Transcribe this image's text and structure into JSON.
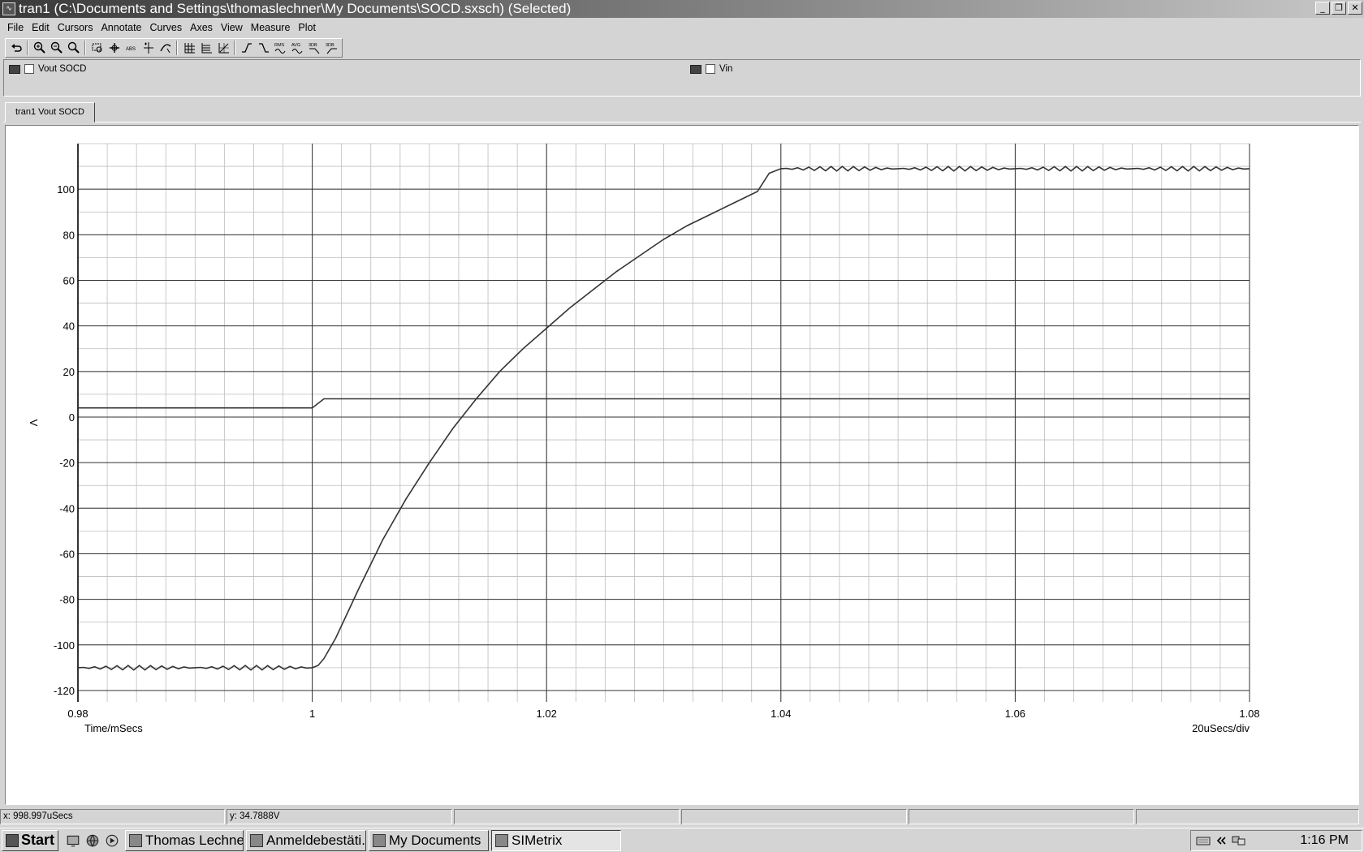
{
  "window": {
    "title": "tran1 (C:\\Documents and Settings\\thomaslechner\\My Documents\\SOCD.sxsch) (Selected)",
    "app_icon": "simetrix-icon",
    "controls": [
      "minimize-icon",
      "restore-icon",
      "close-icon"
    ]
  },
  "menu": [
    "File",
    "Edit",
    "Cursors",
    "Annotate",
    "Curves",
    "Axes",
    "View",
    "Measure",
    "Plot"
  ],
  "toolbar": {
    "groups": [
      [
        "undo-icon"
      ],
      [
        "zoom-in-icon",
        "zoom-out-icon",
        "zoom-full-icon"
      ],
      [
        "zoom-box-icon",
        "pan-icon",
        "abs-icon",
        "cursor-add-icon",
        "curve-select-icon"
      ],
      [
        "grid-icon",
        "separate-axes-icon",
        "log-axes-icon"
      ],
      [
        "rise-time-icon",
        "fall-time-icon",
        "rms-icon",
        "avg-icon",
        "3db-low-icon",
        "3db-high-icon"
      ]
    ],
    "text_icons": {
      "abs-icon": "ABS",
      "rms-icon": "RMS",
      "avg-icon": "AVG",
      "3db-low-icon": "3DB",
      "3db-high-icon": "3DB"
    }
  },
  "legend": [
    {
      "label": "Vout SOCD",
      "color": "#444444"
    },
    {
      "label": "Vin",
      "color": "#444444"
    }
  ],
  "tabs": [
    {
      "label": "tran1 Vout SOCD",
      "active": true
    }
  ],
  "chart_data": {
    "type": "line",
    "xlabel": "Time/mSecs",
    "ylabel": "V",
    "xdiv_label": "20uSecs/div",
    "xlim": [
      0.98,
      1.08
    ],
    "ylim": [
      -125,
      120
    ],
    "x_ticks": [
      0.98,
      1,
      1.02,
      1.04,
      1.06,
      1.08
    ],
    "x_tick_labels": [
      "0.98",
      "1",
      "1.02",
      "1.04",
      "1.06",
      "1.08"
    ],
    "y_ticks": [
      -120,
      -100,
      -80,
      -60,
      -40,
      -20,
      0,
      20,
      40,
      60,
      80,
      100
    ],
    "y_tick_labels": [
      "-120",
      "-100",
      "-80",
      "-60",
      "-40",
      "-20",
      "0",
      "20",
      "40",
      "60",
      "80",
      "100"
    ],
    "grid": true,
    "series": [
      {
        "name": "Vout SOCD",
        "color": "#333333",
        "x": [
          0.98,
          0.99,
          1.0,
          1.0005,
          1.001,
          1.002,
          1.003,
          1.004,
          1.006,
          1.008,
          1.01,
          1.012,
          1.014,
          1.016,
          1.018,
          1.02,
          1.022,
          1.024,
          1.026,
          1.028,
          1.03,
          1.032,
          1.034,
          1.036,
          1.038,
          1.039,
          1.04,
          1.05,
          1.06,
          1.07,
          1.08
        ],
        "y": [
          -110,
          -110,
          -110,
          -109,
          -106,
          -97,
          -86,
          -75,
          -54,
          -36,
          -20,
          -5,
          8,
          20,
          30,
          39,
          48,
          56,
          64,
          71,
          78,
          84,
          89,
          94,
          99,
          107,
          109,
          109,
          109,
          109,
          109
        ],
        "ripple": 1
      },
      {
        "name": "Vin",
        "color": "#333333",
        "x": [
          0.98,
          1.0,
          1.001,
          1.08
        ],
        "y": [
          4,
          4,
          8,
          8
        ]
      }
    ]
  },
  "status": {
    "x_readout": "x: 998.997uSecs",
    "y_readout": "y: 34.7888V"
  },
  "taskbar": {
    "start_label": "Start",
    "quicklaunch": [
      "desktop-icon",
      "browser-icon",
      "media-player-icon"
    ],
    "tasks": [
      {
        "label": "Thomas Lechne...",
        "icon": "email-icon",
        "active": false
      },
      {
        "label": "Anmeldebestäti...",
        "icon": "pdf-icon",
        "active": false
      },
      {
        "label": "My Documents",
        "icon": "folder-icon",
        "active": false
      },
      {
        "label": "SIMetrix",
        "icon": "simetrix-icon",
        "active": true
      }
    ],
    "tray_icons": [
      "keyboard-icon",
      "tray-expand-icon",
      "network-icon"
    ],
    "clock": "1:16 PM"
  }
}
